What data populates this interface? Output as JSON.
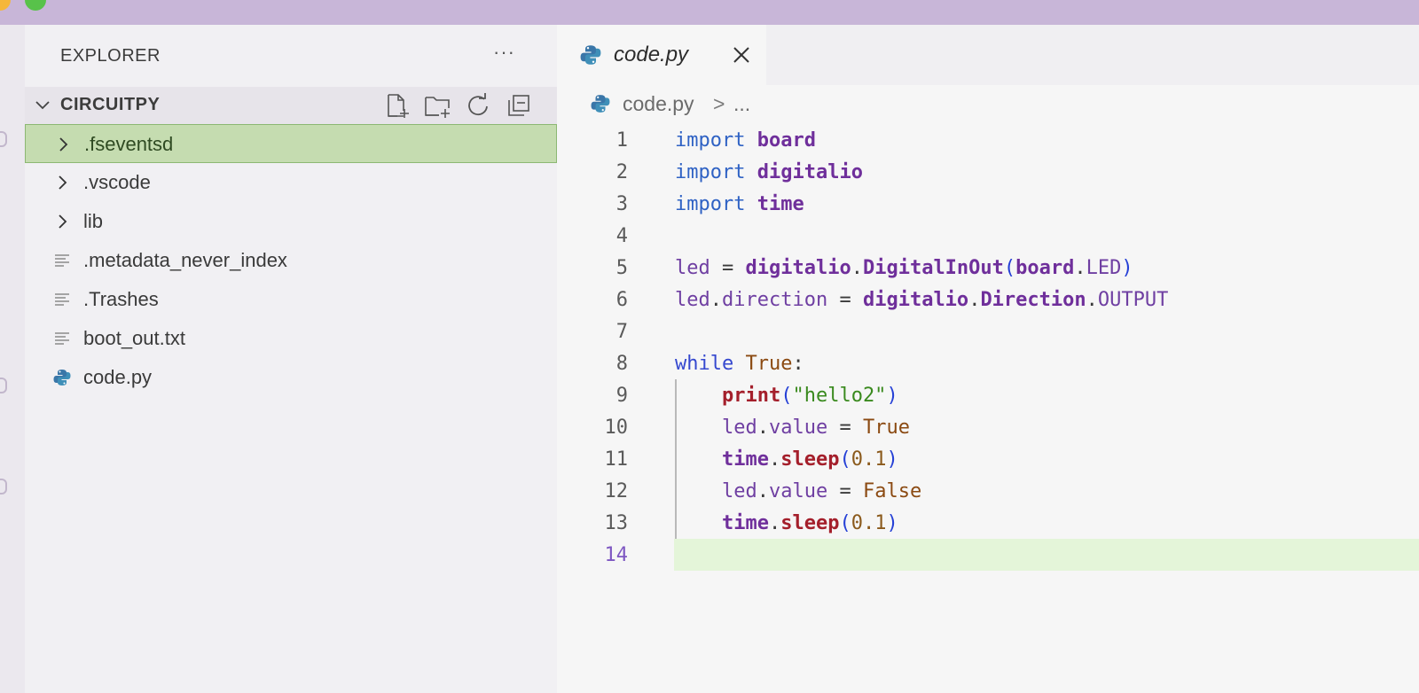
{
  "colors": {
    "titlebar": "#c8b6d8",
    "selected_row": "#c5dcb0",
    "current_line": "#e4f5d9"
  },
  "explorer": {
    "title": "EXPLORER",
    "more_label": "···",
    "section_label": "CIRCUITPY",
    "actions": [
      "new-file",
      "new-folder",
      "refresh",
      "collapse-all"
    ],
    "items": [
      {
        "label": ".fseventsd",
        "kind": "folder",
        "icon": "chevron-right-icon",
        "selected": true
      },
      {
        "label": ".vscode",
        "kind": "folder",
        "icon": "chevron-right-icon"
      },
      {
        "label": "lib",
        "kind": "folder",
        "icon": "chevron-right-icon"
      },
      {
        "label": ".metadata_never_index",
        "kind": "file",
        "icon": "text-file-icon"
      },
      {
        "label": ".Trashes",
        "kind": "file",
        "icon": "text-file-icon"
      },
      {
        "label": "boot_out.txt",
        "kind": "file",
        "icon": "text-file-icon"
      },
      {
        "label": "code.py",
        "kind": "file",
        "icon": "python-icon"
      }
    ]
  },
  "editor": {
    "tab": {
      "label": "code.py",
      "icon": "python-icon",
      "close_icon": "close-icon"
    },
    "breadcrumb": {
      "file": "code.py",
      "separator": ">",
      "rest": "..."
    },
    "active_line": 14,
    "lines": [
      {
        "number": "1",
        "tokens": [
          {
            "t": "import",
            "c": "kw"
          },
          {
            "t": " ",
            "c": "op"
          },
          {
            "t": "board",
            "c": "mod"
          }
        ]
      },
      {
        "number": "2",
        "tokens": [
          {
            "t": "import",
            "c": "kw"
          },
          {
            "t": " ",
            "c": "op"
          },
          {
            "t": "digitalio",
            "c": "mod"
          }
        ]
      },
      {
        "number": "3",
        "tokens": [
          {
            "t": "import",
            "c": "kw"
          },
          {
            "t": " ",
            "c": "op"
          },
          {
            "t": "time",
            "c": "mod"
          }
        ]
      },
      {
        "number": "4",
        "tokens": []
      },
      {
        "number": "5",
        "tokens": [
          {
            "t": "led",
            "c": "pr"
          },
          {
            "t": " = ",
            "c": "op"
          },
          {
            "t": "digitalio",
            "c": "mod"
          },
          {
            "t": ".",
            "c": "op"
          },
          {
            "t": "DigitalInOut",
            "c": "mod"
          },
          {
            "t": "(",
            "c": "p1"
          },
          {
            "t": "board",
            "c": "mod"
          },
          {
            "t": ".",
            "c": "op"
          },
          {
            "t": "LED",
            "c": "enum"
          },
          {
            "t": ")",
            "c": "p1"
          }
        ]
      },
      {
        "number": "6",
        "tokens": [
          {
            "t": "led",
            "c": "pr"
          },
          {
            "t": ".",
            "c": "op"
          },
          {
            "t": "direction",
            "c": "pr"
          },
          {
            "t": " = ",
            "c": "op"
          },
          {
            "t": "digitalio",
            "c": "mod"
          },
          {
            "t": ".",
            "c": "op"
          },
          {
            "t": "Direction",
            "c": "mod"
          },
          {
            "t": ".",
            "c": "op"
          },
          {
            "t": "OUTPUT",
            "c": "enum"
          }
        ]
      },
      {
        "number": "7",
        "tokens": []
      },
      {
        "number": "8",
        "tokens": [
          {
            "t": "while",
            "c": "ctl"
          },
          {
            "t": " ",
            "c": "op"
          },
          {
            "t": "True",
            "c": "const"
          },
          {
            "t": ":",
            "c": "op"
          }
        ]
      },
      {
        "number": "9",
        "tokens": [
          {
            "t": "    ",
            "c": "op"
          },
          {
            "t": "print",
            "c": "fn"
          },
          {
            "t": "(",
            "c": "p1"
          },
          {
            "t": "\"hello2\"",
            "c": "str"
          },
          {
            "t": ")",
            "c": "p1"
          }
        ]
      },
      {
        "number": "10",
        "tokens": [
          {
            "t": "    ",
            "c": "op"
          },
          {
            "t": "led",
            "c": "pr"
          },
          {
            "t": ".",
            "c": "op"
          },
          {
            "t": "value",
            "c": "pr"
          },
          {
            "t": " = ",
            "c": "op"
          },
          {
            "t": "True",
            "c": "const"
          }
        ]
      },
      {
        "number": "11",
        "tokens": [
          {
            "t": "    ",
            "c": "op"
          },
          {
            "t": "time",
            "c": "mod"
          },
          {
            "t": ".",
            "c": "op"
          },
          {
            "t": "sleep",
            "c": "fn"
          },
          {
            "t": "(",
            "c": "p1"
          },
          {
            "t": "0.1",
            "c": "num"
          },
          {
            "t": ")",
            "c": "p1"
          }
        ]
      },
      {
        "number": "12",
        "tokens": [
          {
            "t": "    ",
            "c": "op"
          },
          {
            "t": "led",
            "c": "pr"
          },
          {
            "t": ".",
            "c": "op"
          },
          {
            "t": "value",
            "c": "pr"
          },
          {
            "t": " = ",
            "c": "op"
          },
          {
            "t": "False",
            "c": "const"
          }
        ]
      },
      {
        "number": "13",
        "tokens": [
          {
            "t": "    ",
            "c": "op"
          },
          {
            "t": "time",
            "c": "mod"
          },
          {
            "t": ".",
            "c": "op"
          },
          {
            "t": "sleep",
            "c": "fn"
          },
          {
            "t": "(",
            "c": "p1"
          },
          {
            "t": "0.1",
            "c": "num"
          },
          {
            "t": ")",
            "c": "p1"
          }
        ]
      },
      {
        "number": "14",
        "tokens": []
      }
    ]
  }
}
